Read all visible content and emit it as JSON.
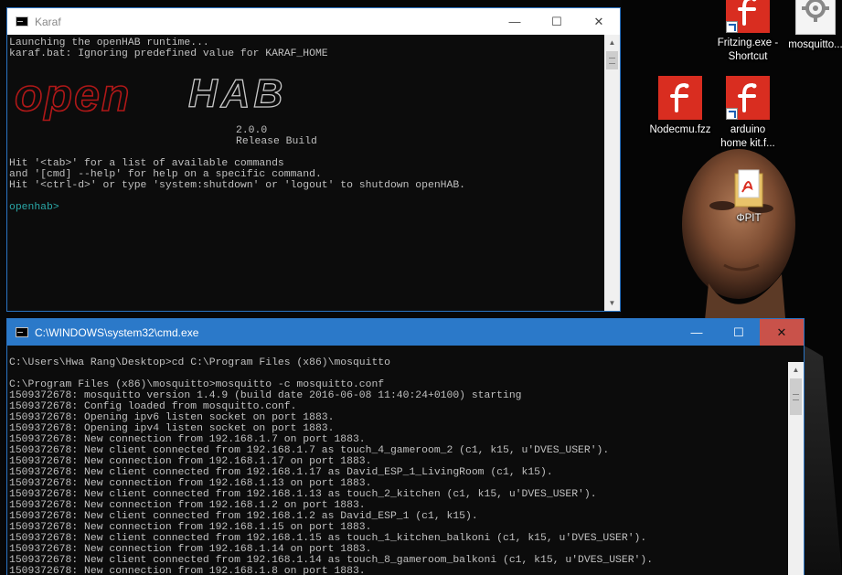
{
  "desktop": {
    "icons": [
      {
        "label": "Fritzing.exe - Shortcut",
        "line1": "Fritzing.exe -",
        "line2": "Shortcut",
        "icon": "fritzing-icon",
        "shortcut": true
      },
      {
        "label": "mosquitto...",
        "line1": "mosquitto...",
        "line2": "",
        "icon": "gear-icon",
        "shortcut": false
      },
      {
        "label": "Nodecmu.fzz",
        "line1": "Nodecmu.fzz",
        "line2": "",
        "icon": "fritzing-icon",
        "shortcut": false
      },
      {
        "label": "arduino home kit.f...",
        "line1": "arduino",
        "line2": "home kit.f...",
        "icon": "fritzing-icon",
        "shortcut": true
      },
      {
        "label": "ΦΡΙΤ",
        "line1": "ΦΡΙΤ",
        "line2": "",
        "icon": "pdf-folder-icon",
        "shortcut": false
      }
    ]
  },
  "karaf_window": {
    "title": "Karaf",
    "controls": {
      "minimize": "—",
      "maximize": "☐",
      "close": "✕"
    },
    "lines_top": [
      "Launching the openHAB runtime...",
      "karaf.bat: Ignoring predefined value for KARAF_HOME"
    ],
    "logo_text": "openHAB",
    "version": "2.0.0",
    "build": "Release Build",
    "lines_help": [
      "Hit '<tab>' for a list of available commands",
      "and '[cmd] --help' for help on a specific command.",
      "Hit '<ctrl-d>' or type 'system:shutdown' or 'logout' to shutdown openHAB."
    ],
    "prompt": "openhab>"
  },
  "cmd_window": {
    "title": "C:\\WINDOWS\\system32\\cmd.exe",
    "controls": {
      "minimize": "—",
      "maximize": "☐",
      "close": "✕"
    },
    "lines": [
      "C:\\Users\\Hwa Rang\\Desktop>cd C:\\Program Files (x86)\\mosquitto",
      "",
      "C:\\Program Files (x86)\\mosquitto>mosquitto -c mosquitto.conf",
      "1509372678: mosquitto version 1.4.9 (build date 2016-06-08 11:40:24+0100) starting",
      "1509372678: Config loaded from mosquitto.conf.",
      "1509372678: Opening ipv6 listen socket on port 1883.",
      "1509372678: Opening ipv4 listen socket on port 1883.",
      "1509372678: New connection from 192.168.1.7 on port 1883.",
      "1509372678: New client connected from 192.168.1.7 as touch_4_gameroom_2 (c1, k15, u'DVES_USER').",
      "1509372678: New connection from 192.168.1.17 on port 1883.",
      "1509372678: New client connected from 192.168.1.17 as David_ESP_1_LivingRoom (c1, k15).",
      "1509372678: New connection from 192.168.1.13 on port 1883.",
      "1509372678: New client connected from 192.168.1.13 as touch_2_kitchen (c1, k15, u'DVES_USER').",
      "1509372678: New connection from 192.168.1.2 on port 1883.",
      "1509372678: New client connected from 192.168.1.2 as David_ESP_1 (c1, k15).",
      "1509372678: New connection from 192.168.1.15 on port 1883.",
      "1509372678: New client connected from 192.168.1.15 as touch_1_kitchen_balkoni (c1, k15, u'DVES_USER').",
      "1509372678: New connection from 192.168.1.14 on port 1883.",
      "1509372678: New client connected from 192.168.1.14 as touch_8_gameroom_balkoni (c1, k15, u'DVES_USER').",
      "1509372678: New connection from 192.168.1.8 on port 1883."
    ]
  },
  "colors": {
    "console_bg": "#0c0c0c",
    "console_text": "#c0c0c0",
    "active_titlebar": "#2b79c9",
    "logo_red": "#b01818",
    "prompt": "#2aa8a8",
    "fritzing_red": "#d92d20"
  }
}
